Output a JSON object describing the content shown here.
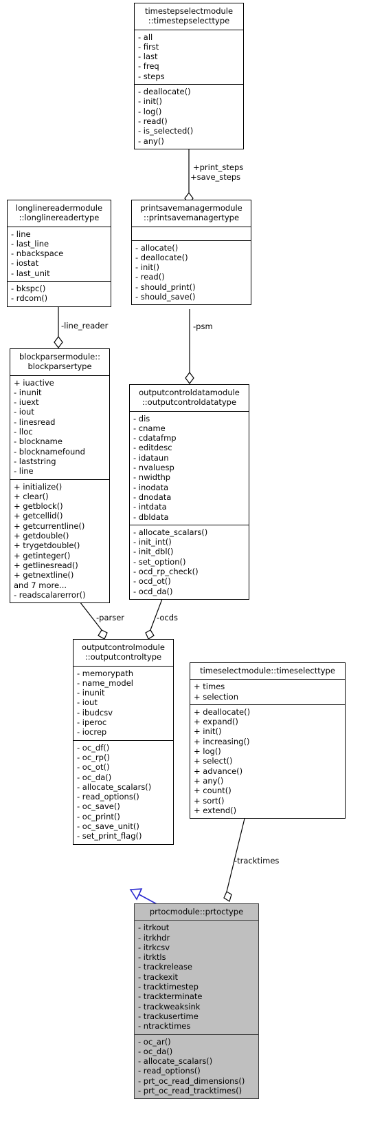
{
  "diagram": {
    "type": "uml-class-diagram",
    "background": "#ffffff",
    "highlight_fill": "#bfbfbf",
    "inheritance_arrow_color": "#2a2ad0"
  },
  "nodes": {
    "timestepselect": {
      "title": "timestepselectmodule\n::timestepselecttype",
      "attributes": [
        "- all",
        "- first",
        "- last",
        "- freq",
        "- steps"
      ],
      "operations": [
        "- deallocate()",
        "- init()",
        "- log()",
        "- read()",
        "- is_selected()",
        "- any()"
      ]
    },
    "longlinereader": {
      "title": "longlinereadermodule\n::longlinereadertype",
      "attributes": [
        "- line",
        "- last_line",
        "- nbackspace",
        "- iostat",
        "- last_unit"
      ],
      "operations": [
        "- bkspc()",
        "- rdcom()"
      ]
    },
    "printsavemanager": {
      "title": "printsavemanagermodule\n::printsavemanagertype",
      "attributes": [],
      "operations": [
        "- allocate()",
        "- deallocate()",
        "- init()",
        "- read()",
        "- should_print()",
        "- should_save()"
      ]
    },
    "blockparser": {
      "title": "blockparsermodule::\nblockparsertype",
      "attributes": [
        "+ iuactive",
        "- inunit",
        "- iuext",
        "- iout",
        "- linesread",
        "- lloc",
        "- blockname",
        "- blocknamefound",
        "- laststring",
        "- line"
      ],
      "operations": [
        "+ initialize()",
        "+ clear()",
        "+ getblock()",
        "+ getcellid()",
        "+ getcurrentline()",
        "+ getdouble()",
        "+ trygetdouble()",
        "+ getinteger()",
        "+ getlinesread()",
        "+ getnextline()",
        "and 7 more...",
        "- readscalarerror()"
      ]
    },
    "outputcontroldata": {
      "title": "outputcontroldatamodule\n::outputcontroldatatype",
      "attributes": [
        "- dis",
        "- cname",
        "- cdatafmp",
        "- editdesc",
        "- idataun",
        "- nvaluesp",
        "- nwidthp",
        "- inodata",
        "- dnodata",
        "- intdata",
        "- dbldata"
      ],
      "operations": [
        "- allocate_scalars()",
        "- init_int()",
        "- init_dbl()",
        "- set_option()",
        "- ocd_rp_check()",
        "- ocd_ot()",
        "- ocd_da()"
      ]
    },
    "outputcontrol": {
      "title": "outputcontrolmodule\n::outputcontroltype",
      "attributes": [
        "- memorypath",
        "- name_model",
        "- inunit",
        "- iout",
        "- ibudcsv",
        "- iperoc",
        "- iocrep"
      ],
      "operations": [
        "- oc_df()",
        "- oc_rp()",
        "- oc_ot()",
        "- oc_da()",
        "- allocate_scalars()",
        "- read_options()",
        "- oc_save()",
        "- oc_print()",
        "- oc_save_unit()",
        "- set_print_flag()"
      ]
    },
    "timeselect": {
      "title": "timeselectmodule::timeselecttype",
      "attributes": [
        "+ times",
        "+ selection"
      ],
      "operations": [
        "+ deallocate()",
        "+ expand()",
        "+ init()",
        "+ increasing()",
        "+ log()",
        "+ select()",
        "+ advance()",
        "+ any()",
        "+ count()",
        "+ sort()",
        "+ extend()"
      ]
    },
    "prtoc": {
      "title": "prtocmodule::prtoctype",
      "attributes": [
        "- itrkout",
        "- itrkhdr",
        "- itrkcsv",
        "- itrktls",
        "- trackrelease",
        "- trackexit",
        "- tracktimestep",
        "- trackterminate",
        "- trackweaksink",
        "- trackusertime",
        "- ntracktimes"
      ],
      "operations": [
        "- oc_ar()",
        "- oc_da()",
        "- allocate_scalars()",
        "- read_options()",
        "- prt_oc_read_dimensions()",
        "- prt_oc_read_tracktimes()"
      ]
    }
  },
  "edge_labels": {
    "print_steps": "+print_steps",
    "save_steps": "+save_steps",
    "line_reader": "-line_reader",
    "psm": "-psm",
    "parser": "-parser",
    "ocds": "-ocds",
    "tracktimes": "-tracktimes"
  }
}
